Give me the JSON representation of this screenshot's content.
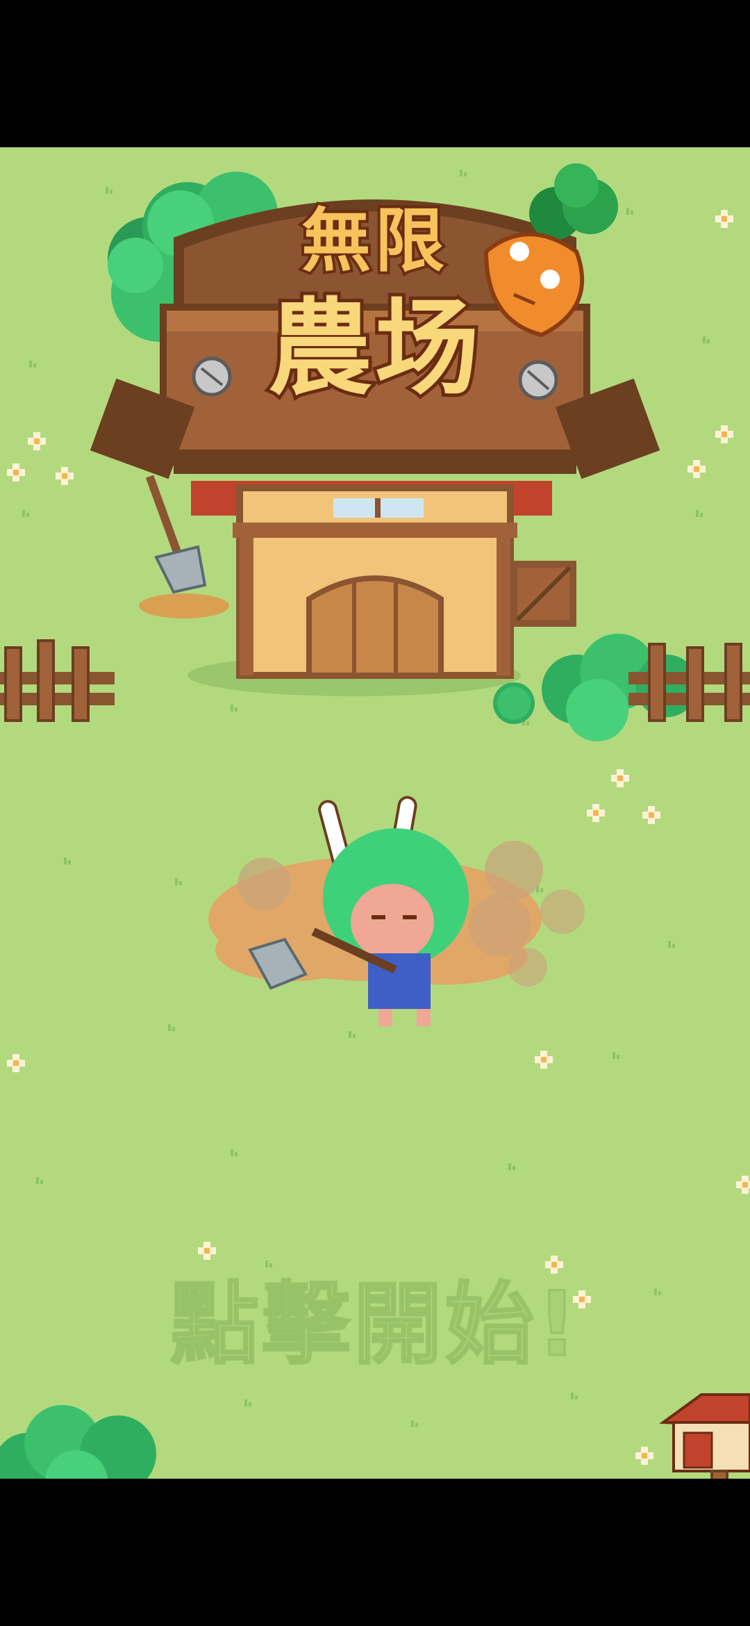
{
  "game": {
    "title_line1": "無限",
    "title_line2": "農场",
    "tap_to_start": "點擊開始!"
  },
  "colors": {
    "grass": "#b3d97f",
    "wood": "#8a5530",
    "title_fill": "#f7c35c",
    "hair": "#3fd07a"
  }
}
